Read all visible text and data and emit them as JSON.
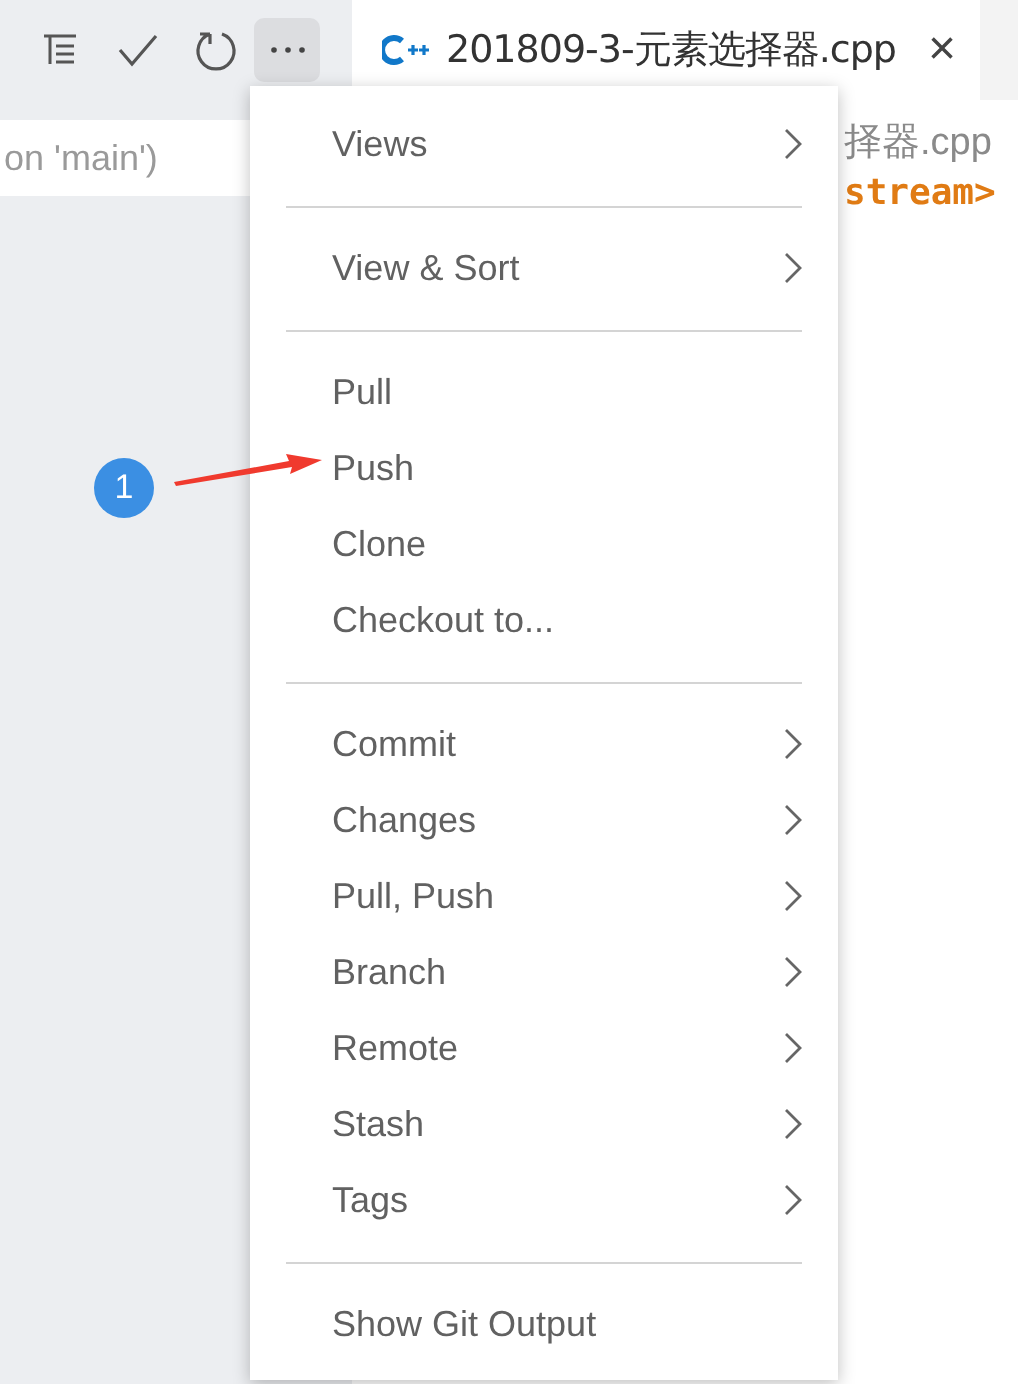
{
  "commit_message": {
    "placeholder": "on 'main')"
  },
  "editor_tab": {
    "title": "201809-3-元素选择器.cpp",
    "close": "×"
  },
  "editor_lines": [
    {
      "kind": "comment",
      "text": "择器.cpp"
    },
    {
      "kind": "include",
      "text": "stream>"
    }
  ],
  "menu": {
    "groups": [
      [
        {
          "label": "Views",
          "submenu": true
        }
      ],
      [
        {
          "label": "View & Sort",
          "submenu": true
        }
      ],
      [
        {
          "label": "Pull",
          "submenu": false
        },
        {
          "label": "Push",
          "submenu": false
        },
        {
          "label": "Clone",
          "submenu": false
        },
        {
          "label": "Checkout to...",
          "submenu": false
        }
      ],
      [
        {
          "label": "Commit",
          "submenu": true
        },
        {
          "label": "Changes",
          "submenu": true
        },
        {
          "label": "Pull, Push",
          "submenu": true
        },
        {
          "label": "Branch",
          "submenu": true
        },
        {
          "label": "Remote",
          "submenu": true
        },
        {
          "label": "Stash",
          "submenu": true
        },
        {
          "label": "Tags",
          "submenu": true
        }
      ],
      [
        {
          "label": "Show Git Output",
          "submenu": false
        }
      ]
    ]
  },
  "annotation": {
    "badge": "1"
  }
}
